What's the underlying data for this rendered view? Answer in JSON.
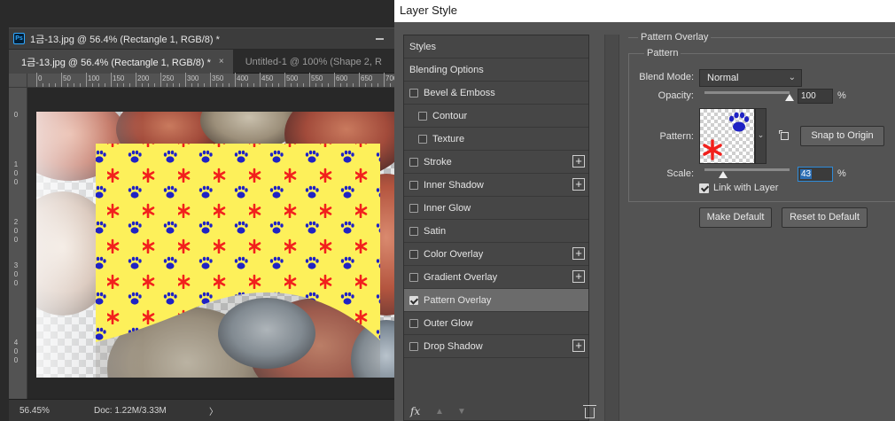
{
  "document_window": {
    "app_icon_text": "Ps",
    "title": "1금-13.jpg @ 56.4% (Rectangle 1, RGB/8) *",
    "tabs": [
      {
        "label": "1금-13.jpg @ 56.4% (Rectangle 1, RGB/8) *",
        "close": "×"
      },
      {
        "label": "Untitled-1 @ 100% (Shape 2, R"
      }
    ],
    "ruler_top": [
      "0",
      "50",
      "100",
      "150",
      "200",
      "250",
      "300",
      "350",
      "400",
      "450",
      "500",
      "550",
      "600",
      "650",
      "700",
      "750"
    ],
    "ruler_left": [
      [
        "0"
      ],
      [
        "1",
        "0",
        "0"
      ],
      [
        "2",
        "0",
        "0"
      ],
      [
        "3",
        "0",
        "0"
      ],
      [
        "4",
        "0",
        "0"
      ]
    ],
    "status": {
      "zoom": "56.45%",
      "doc_size": "Doc: 1.22M/3.33M",
      "arrow": "〉"
    }
  },
  "layer_style": {
    "title": "Layer Style",
    "styles": [
      {
        "label": "Styles",
        "has_checkbox": false,
        "checked": false,
        "plus": false,
        "indent": false
      },
      {
        "label": "Blending Options",
        "has_checkbox": false,
        "checked": false,
        "plus": false,
        "indent": false
      },
      {
        "label": "Bevel & Emboss",
        "has_checkbox": true,
        "checked": false,
        "plus": false,
        "indent": false
      },
      {
        "label": "Contour",
        "has_checkbox": true,
        "checked": false,
        "plus": false,
        "indent": true
      },
      {
        "label": "Texture",
        "has_checkbox": true,
        "checked": false,
        "plus": false,
        "indent": true
      },
      {
        "label": "Stroke",
        "has_checkbox": true,
        "checked": false,
        "plus": true,
        "indent": false
      },
      {
        "label": "Inner Shadow",
        "has_checkbox": true,
        "checked": false,
        "plus": true,
        "indent": false
      },
      {
        "label": "Inner Glow",
        "has_checkbox": true,
        "checked": false,
        "plus": false,
        "indent": false
      },
      {
        "label": "Satin",
        "has_checkbox": true,
        "checked": false,
        "plus": false,
        "indent": false
      },
      {
        "label": "Color Overlay",
        "has_checkbox": true,
        "checked": false,
        "plus": true,
        "indent": false
      },
      {
        "label": "Gradient Overlay",
        "has_checkbox": true,
        "checked": false,
        "plus": true,
        "indent": false
      },
      {
        "label": "Pattern Overlay",
        "has_checkbox": true,
        "checked": true,
        "plus": false,
        "indent": false,
        "selected": true
      },
      {
        "label": "Outer Glow",
        "has_checkbox": true,
        "checked": false,
        "plus": false,
        "indent": false
      },
      {
        "label": "Drop Shadow",
        "has_checkbox": true,
        "checked": false,
        "plus": true,
        "indent": false
      }
    ],
    "footer": {
      "fx": "fx",
      "up_arrow": "▲",
      "down_arrow": "▼"
    },
    "pattern_overlay": {
      "section_title": "Pattern Overlay",
      "group_title": "Pattern",
      "blend_mode_label": "Blend Mode:",
      "blend_mode_value": "Normal",
      "opacity_label": "Opacity:",
      "opacity_value": "100",
      "opacity_fraction": 1.0,
      "percent": "%",
      "pattern_label": "Pattern:",
      "snap_button": "Snap to Origin",
      "scale_label": "Scale:",
      "scale_value": "43",
      "scale_fraction": 0.11,
      "link_label": "Link with Layer",
      "link_checked": true,
      "make_default": "Make Default",
      "reset_default": "Reset to Default"
    }
  },
  "colors": {
    "pattern_background": "#fdf05a",
    "paw_blue": "#1f22c4",
    "star_red": "#f2201c",
    "dialog_bg": "#535353",
    "selected_row": "#6b6b6b"
  }
}
